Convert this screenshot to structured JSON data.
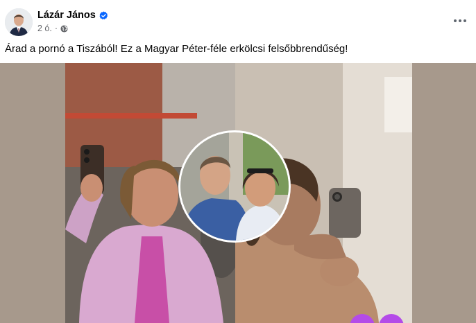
{
  "post": {
    "author": "Lázár János",
    "time": "2 ó.",
    "text": "Árad a pornó a Tiszából! Ez a Magyar Péter-féle erkölcsi felsőbbrendűség!"
  },
  "icons": {
    "avatar": "profile-avatar",
    "verified": "verified-badge-icon",
    "audience": "globe-icon",
    "more": "more-options-icon"
  },
  "colors": {
    "verified_blue": "#0866ff",
    "meta_gray": "#65676b",
    "text_dark": "#050505"
  }
}
